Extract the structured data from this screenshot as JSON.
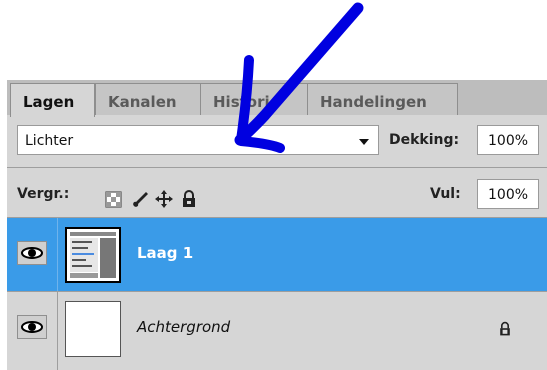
{
  "tabs": [
    "Lagen",
    "Kanalen",
    "Historie",
    "Handelingen"
  ],
  "blend_mode": "Lichter",
  "opacity": {
    "label": "Dekking:",
    "value": "100%"
  },
  "lock": {
    "label": "Vergr.:"
  },
  "fill": {
    "label": "Vul:",
    "value": "100%"
  },
  "layers": [
    {
      "name": "Laag 1",
      "selected": true,
      "visible": true
    },
    {
      "name": "Achtergrond",
      "selected": false,
      "visible": true,
      "locked": true
    }
  ],
  "colors": {
    "selection": "#3a9be8",
    "annotation_arrow": "#0000e0"
  }
}
